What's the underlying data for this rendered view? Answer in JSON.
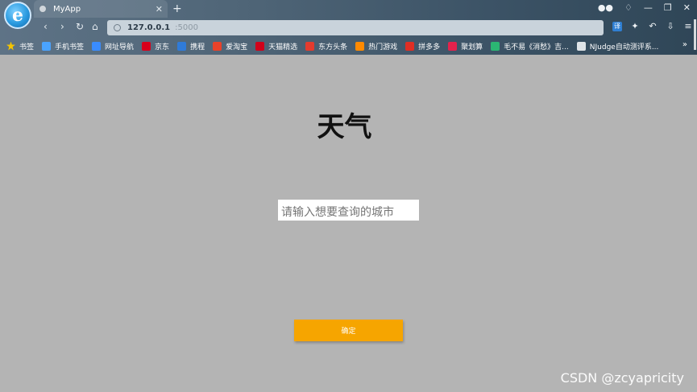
{
  "browser": {
    "logo_letter": "e",
    "tab_title": "MyApp",
    "tab_close": "✕",
    "new_tab": "+",
    "address_url": "127.0.0.1",
    "address_rest": ":5000",
    "nav": {
      "back": "‹",
      "forward": "›",
      "reload": "↻",
      "home": "⌂"
    },
    "window_controls": {
      "minimize": "—",
      "restore": "❐",
      "close": "✕"
    },
    "toolbar": {
      "translate": "译",
      "extensions": "✦",
      "undo": "↶",
      "download": "⇩",
      "menu": "≡"
    },
    "bookmarks": [
      {
        "label": "书签",
        "color": "#f5c400"
      },
      {
        "label": "手机书签",
        "color": "#4aa3ff"
      },
      {
        "label": "网址导航",
        "color": "#3a8cff"
      },
      {
        "label": "京东",
        "color": "#d8001b"
      },
      {
        "label": "携程",
        "color": "#2f7bd9"
      },
      {
        "label": "爱淘宝",
        "color": "#e8422a"
      },
      {
        "label": "天猫精选",
        "color": "#d0021b"
      },
      {
        "label": "东方头条",
        "color": "#e33b2e"
      },
      {
        "label": "热门游戏",
        "color": "#ff8a00"
      },
      {
        "label": "拼多多",
        "color": "#e02e24"
      },
      {
        "label": "聚划算",
        "color": "#e5224c"
      },
      {
        "label": "毛不易《消愁》吉...",
        "color": "#2bb673"
      },
      {
        "label": "NJudge自动测评系...",
        "color": "#dfe4e8"
      }
    ],
    "bookmarks_more": "»"
  },
  "page": {
    "title": "天气",
    "city_input_placeholder": "请输入想要查询的城市",
    "city_input_value": "",
    "confirm_label": "确定"
  },
  "watermark": "CSDN @zcyapricity",
  "colors": {
    "page_background": "#b4b4b4",
    "button_background": "#f6a500"
  }
}
